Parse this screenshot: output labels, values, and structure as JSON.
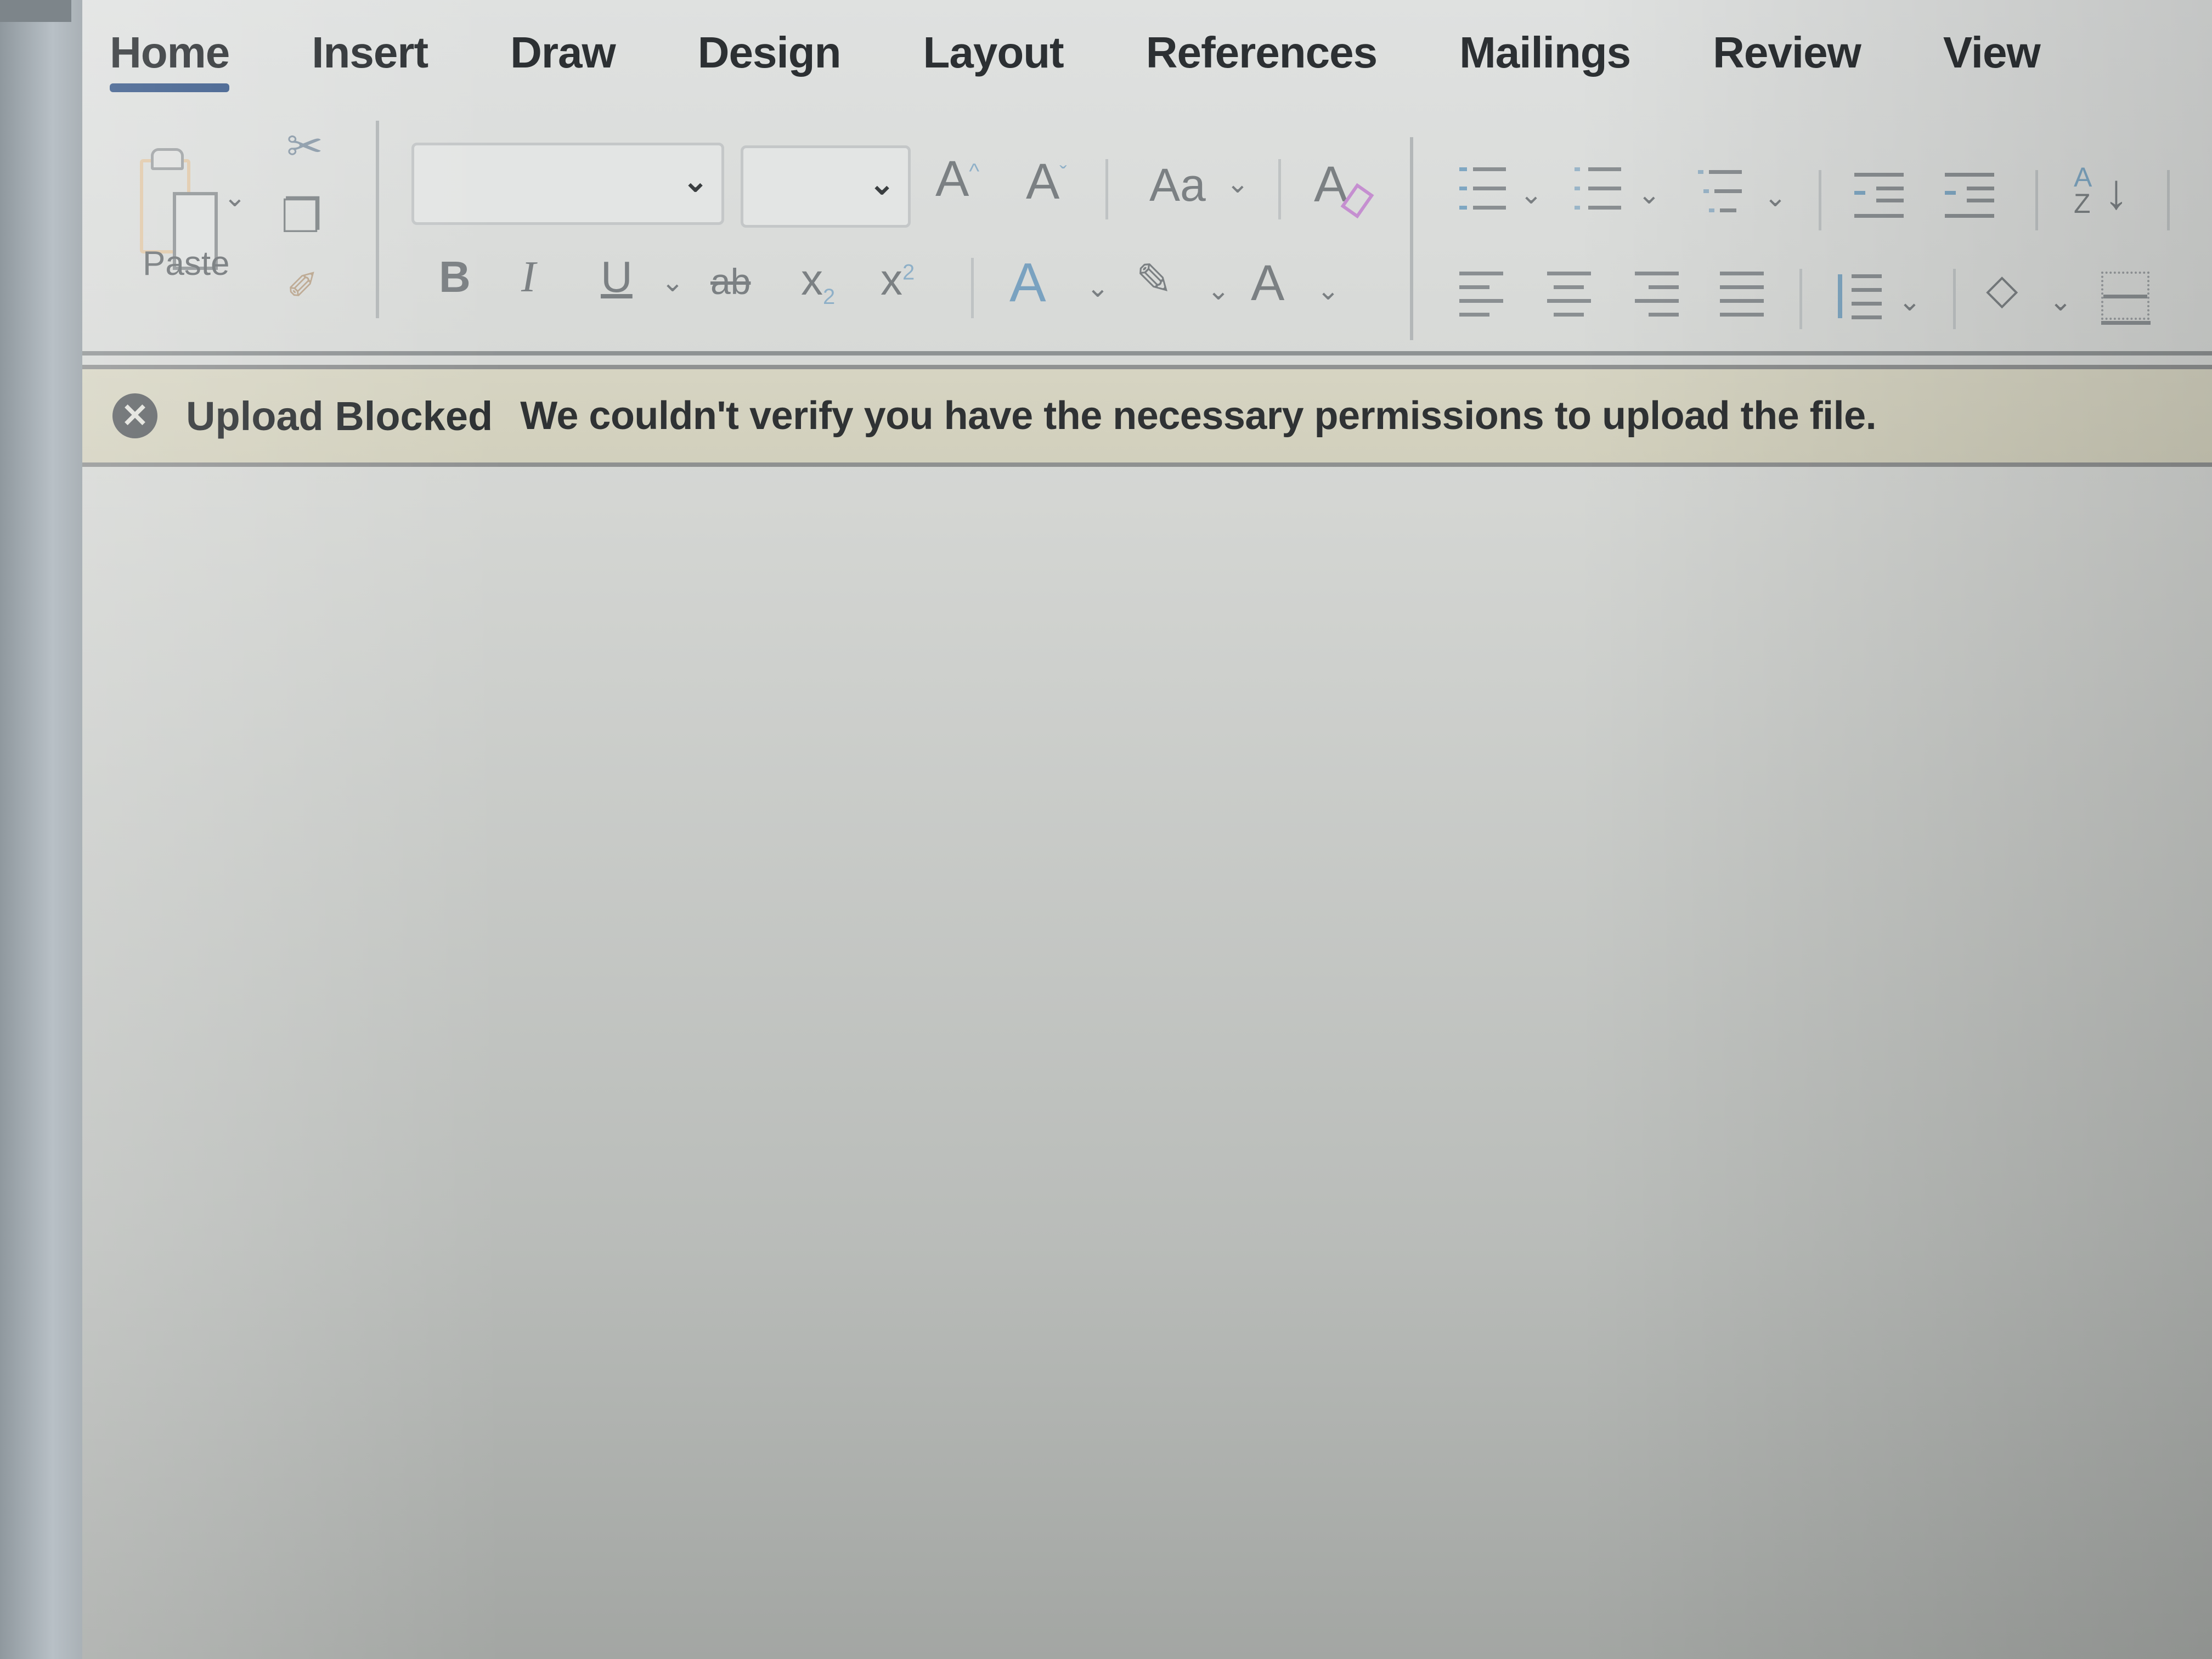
{
  "ribbon_tabs": [
    {
      "label": "Home",
      "active": true
    },
    {
      "label": "Insert",
      "active": false
    },
    {
      "label": "Draw",
      "active": false
    },
    {
      "label": "Design",
      "active": false
    },
    {
      "label": "Layout",
      "active": false
    },
    {
      "label": "References",
      "active": false
    },
    {
      "label": "Mailings",
      "active": false
    },
    {
      "label": "Review",
      "active": false
    },
    {
      "label": "View",
      "active": false
    }
  ],
  "clipboard": {
    "paste_label": "Paste",
    "icons": [
      "paste-icon",
      "cut-icon",
      "copy-icon",
      "format-painter-icon"
    ]
  },
  "font": {
    "font_name_value": "",
    "font_size_value": "",
    "grow_font_glyph": "A",
    "shrink_font_glyph": "A",
    "change_case_glyph": "Aa",
    "clear_formatting_glyph": "A",
    "bold_glyph": "B",
    "italic_glyph": "I",
    "underline_glyph": "U",
    "strikethrough_glyph": "ab",
    "subscript_glyph": "x",
    "superscript_glyph": "x",
    "text_effects_glyph": "A",
    "font_color_glyph": "A",
    "sub_mark": "2",
    "sup_mark": "2"
  },
  "paragraph": {
    "icons": [
      "bullets-icon",
      "numbering-icon",
      "multilevel-list-icon",
      "decrease-indent-icon",
      "increase-indent-icon",
      "sort-icon",
      "align-left-icon",
      "align-center-icon",
      "align-right-icon",
      "justify-icon",
      "line-spacing-icon",
      "shading-icon",
      "borders-icon"
    ],
    "sort_glyph_top": "A",
    "sort_glyph_bottom": "Z"
  },
  "infobar": {
    "icon": "error-circle-icon",
    "icon_glyph": "✕",
    "title": "Upload Blocked",
    "message": "We couldn't verify you have the necessary permissions to upload the file.",
    "background_color": "#d4d2bf"
  },
  "colors": {
    "active_tab_underline": "#3a5a8a",
    "text_dark": "#2c3033"
  }
}
